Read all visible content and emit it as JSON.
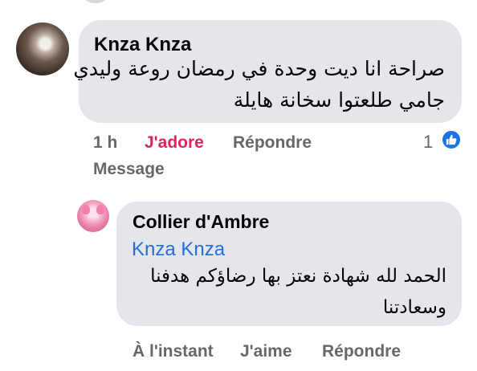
{
  "comment": {
    "author": "Knza Knza",
    "text_lines": [
      "صراحة انا ديت وحدة في رمضان روعة وليدي",
      "جامي طلعتوا سخانة هايلة"
    ],
    "timestamp": "1 h",
    "react_label": "J'adore",
    "reply_label": "Répondre",
    "message_label": "Message",
    "reaction_count": "1",
    "reaction_icon": "like-icon",
    "react_color": "#e0245e"
  },
  "reply": {
    "author": "Collier d'Ambre",
    "mention": "Knza Knza",
    "text_lines": [
      "الحمد لله شهادة نعتز بها رضاؤكم هدفنا",
      "وسعادتنا"
    ],
    "timestamp": "À l'instant",
    "like_label": "J'aime",
    "reply_label": "Répondre",
    "mention_color": "#216fdb"
  }
}
